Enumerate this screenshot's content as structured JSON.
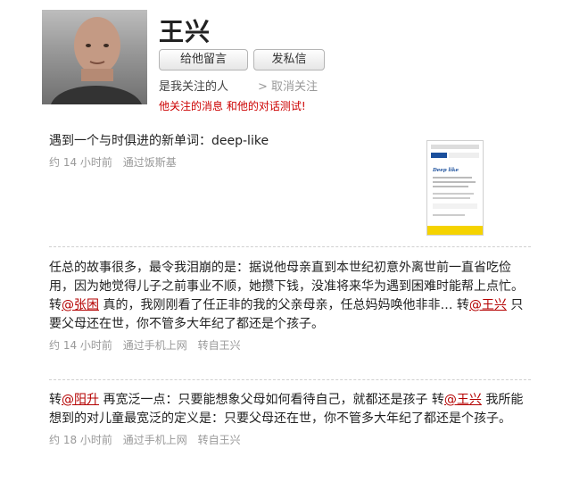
{
  "profile": {
    "name": "王兴",
    "leave_message_label": "给他留言",
    "direct_message_label": "发私信",
    "following_status": "是我关注的人",
    "unfollow_label": "> 取消关注",
    "notice": "他关注的消息 和他的对话测试!"
  },
  "posts": [
    {
      "text": "遇到一个与时俱进的新单词：deep-like",
      "time": "约 14 小时前",
      "source": "通过饭斯基",
      "has_thumbnail": true,
      "thumbnail_title": "Deep like"
    },
    {
      "part1": "任总的故事很多，最令我泪崩的是：据说他母亲直到本世纪初意外离世前一直省吃俭用，因为她觉得儿子之前事业不顺，她攒下钱，没准将来华为遇到困难时能帮上点忙。转",
      "mention1": "@张困",
      "part2": " 真的，我刚刚看了任正非的我的父亲母亲，任总妈妈唤他非非… 转",
      "mention2": "@王兴",
      "part3": " 只要父母还在世，你不管多大年纪了都还是个孩子。",
      "time": "约 14 小时前",
      "source": "通过手机上网",
      "repost": "转自王兴"
    },
    {
      "part1": "转",
      "mention1": "@阳升",
      "part2": " 再宽泛一点：只要能想象父母如何看待自己，就都还是孩子 转",
      "mention2": "@王兴",
      "part3": " 我所能想到的对儿童最宽泛的定义是：只要父母还在世，你不管多大年纪了都还是个孩子。",
      "time": "约 18 小时前",
      "source": "通过手机上网",
      "repost": "转自王兴"
    }
  ]
}
